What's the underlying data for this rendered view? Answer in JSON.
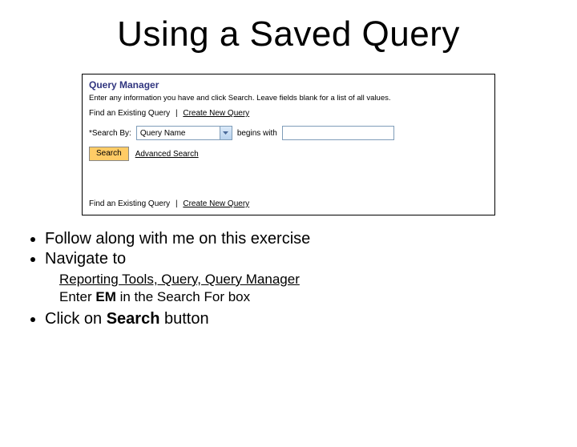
{
  "title": "Using a Saved Query",
  "qm": {
    "heading": "Query Manager",
    "instruction": "Enter any information you have and click Search. Leave fields blank for a list of all values.",
    "find_link": "Find an Existing Query",
    "create_link": "Create New Query",
    "search_by_label": "*Search By:",
    "dropdown_value": "Query Name",
    "begins_with": "begins with",
    "search_value": "",
    "search_button": "Search",
    "advanced_search": "Advanced Search"
  },
  "bullets": {
    "b1": "Follow along with me on this exercise",
    "b2": "Navigate to",
    "nav_path": "Reporting Tools, Query, Query Manager",
    "enter_pre": "Enter ",
    "enter_bold": "EM",
    "enter_post": " in the Search For box",
    "b3_pre": "Click on ",
    "b3_bold": "Search",
    "b3_post": " button"
  }
}
